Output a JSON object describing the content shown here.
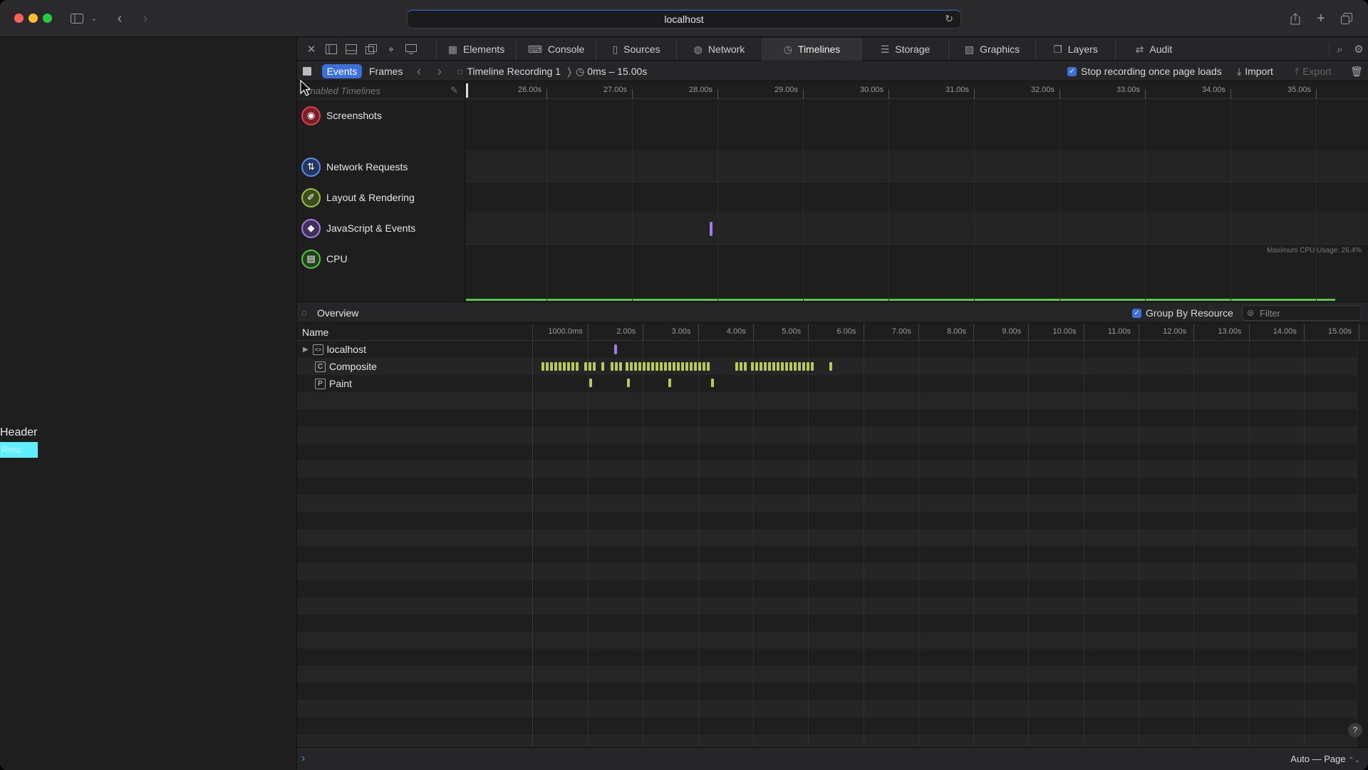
{
  "browser": {
    "address": "localhost"
  },
  "page": {
    "header_text": "Header",
    "rest_text": "Rest"
  },
  "inspector": {
    "tabs": [
      {
        "label": "Elements",
        "icon": "elements-icon"
      },
      {
        "label": "Console",
        "icon": "console-icon"
      },
      {
        "label": "Sources",
        "icon": "sources-icon"
      },
      {
        "label": "Network",
        "icon": "network-icon"
      },
      {
        "label": "Timelines",
        "icon": "timelines-icon",
        "active": true
      },
      {
        "label": "Storage",
        "icon": "storage-icon"
      },
      {
        "label": "Graphics",
        "icon": "graphics-icon"
      },
      {
        "label": "Layers",
        "icon": "layers-icon"
      },
      {
        "label": "Audit",
        "icon": "audit-icon"
      }
    ],
    "subbar": {
      "events_label": "Events",
      "frames_label": "Frames",
      "recording_label": "Timeline Recording 1",
      "range_label": "0ms – 15.00s",
      "stop_recording_label": "Stop recording once page loads",
      "stop_recording_checked": true,
      "import_label": "Import",
      "export_label": "Export"
    },
    "timelines": {
      "enabled_label": "Enabled Timelines",
      "ruler_ticks": [
        "26.00s",
        "27.00s",
        "28.00s",
        "29.00s",
        "30.00s",
        "31.00s",
        "32.00s",
        "33.00s",
        "34.00s",
        "35.00s"
      ],
      "rows": [
        {
          "label": "Screenshots",
          "icon": "camera-icon",
          "color": "#d9434f"
        },
        {
          "label": "Network Requests",
          "icon": "network-arrows-icon",
          "color": "#5b8def"
        },
        {
          "label": "Layout & Rendering",
          "icon": "paintbrush-icon",
          "color": "#9cc24a"
        },
        {
          "label": "JavaScript & Events",
          "icon": "js-diamond-icon",
          "color": "#a77ce6"
        },
        {
          "label": "CPU",
          "icon": "cpu-icon",
          "color": "#5cc34a"
        }
      ],
      "cpu_max_label": "Maximum CPU Usage: 26.4%"
    },
    "overview": {
      "title": "Overview",
      "group_by_resource_label": "Group By Resource",
      "group_by_resource_checked": true,
      "filter_placeholder": "Filter",
      "name_column": "Name",
      "time_ticks": [
        "1000.0ms",
        "2.00s",
        "3.00s",
        "4.00s",
        "5.00s",
        "6.00s",
        "7.00s",
        "8.00s",
        "9.00s",
        "10.00s",
        "11.00s",
        "12.00s",
        "13.00s",
        "14.00s",
        "15.00s"
      ],
      "records": [
        {
          "name": "localhost",
          "icon_letter": "<>",
          "expandable": true
        },
        {
          "name": "Composite",
          "icon_letter": "C",
          "expandable": false
        },
        {
          "name": "Paint",
          "icon_letter": "P",
          "expandable": false
        }
      ]
    },
    "footer": {
      "zoom_label": "Auto — Page"
    }
  },
  "colors": {
    "accent": "#3b6fd9",
    "composite": "#b5c95c",
    "script": "#a77ce6",
    "cpu": "#5cc34a"
  }
}
